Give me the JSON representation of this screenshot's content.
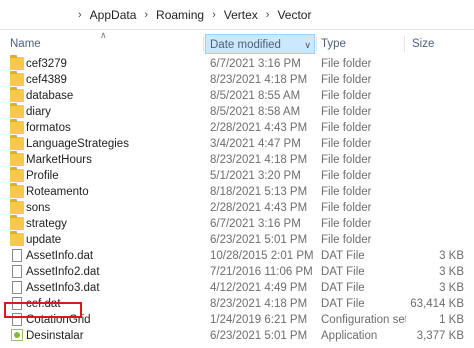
{
  "breadcrumb": [
    "AppData",
    "Roaming",
    "Vertex",
    "Vector"
  ],
  "columns": {
    "name": "Name",
    "date": "Date modified",
    "type": "Type",
    "size": "Size"
  },
  "rows": [
    {
      "name": "cef3279",
      "date": "6/7/2021 3:16 PM",
      "type": "File folder",
      "size": "",
      "icon": "folder"
    },
    {
      "name": "cef4389",
      "date": "8/23/2021 4:18 PM",
      "type": "File folder",
      "size": "",
      "icon": "folder"
    },
    {
      "name": "database",
      "date": "8/5/2021 8:55 AM",
      "type": "File folder",
      "size": "",
      "icon": "folder"
    },
    {
      "name": "diary",
      "date": "8/5/2021 8:58 AM",
      "type": "File folder",
      "size": "",
      "icon": "folder"
    },
    {
      "name": "formatos",
      "date": "2/28/2021 4:43 PM",
      "type": "File folder",
      "size": "",
      "icon": "folder"
    },
    {
      "name": "LanguageStrategies",
      "date": "3/4/2021 4:47 PM",
      "type": "File folder",
      "size": "",
      "icon": "folder"
    },
    {
      "name": "MarketHours",
      "date": "8/23/2021 4:18 PM",
      "type": "File folder",
      "size": "",
      "icon": "folder"
    },
    {
      "name": "Profile",
      "date": "5/1/2021 3:20 PM",
      "type": "File folder",
      "size": "",
      "icon": "folder"
    },
    {
      "name": "Roteamento",
      "date": "8/18/2021 5:13 PM",
      "type": "File folder",
      "size": "",
      "icon": "folder"
    },
    {
      "name": "sons",
      "date": "2/28/2021 4:43 PM",
      "type": "File folder",
      "size": "",
      "icon": "folder"
    },
    {
      "name": "strategy",
      "date": "6/7/2021 3:16 PM",
      "type": "File folder",
      "size": "",
      "icon": "folder"
    },
    {
      "name": "update",
      "date": "6/23/2021 5:01 PM",
      "type": "File folder",
      "size": "",
      "icon": "folder"
    },
    {
      "name": "AssetInfo.dat",
      "date": "10/28/2015 2:01 PM",
      "type": "DAT File",
      "size": "3 KB",
      "icon": "file"
    },
    {
      "name": "AssetInfo2.dat",
      "date": "7/21/2016 11:06 PM",
      "type": "DAT File",
      "size": "3 KB",
      "icon": "file"
    },
    {
      "name": "AssetInfo3.dat",
      "date": "4/12/2021 4:49 PM",
      "type": "DAT File",
      "size": "3 KB",
      "icon": "file"
    },
    {
      "name": "cef.dat",
      "date": "8/23/2021 4:18 PM",
      "type": "DAT File",
      "size": "63,414 KB",
      "icon": "file"
    },
    {
      "name": "CotationGrid",
      "date": "1/24/2019 6:21 PM",
      "type": "Configuration sett...",
      "size": "1 KB",
      "icon": "file"
    },
    {
      "name": "Desinstalar",
      "date": "6/23/2021 5:01 PM",
      "type": "Application",
      "size": "3,377 KB",
      "icon": "app"
    }
  ]
}
